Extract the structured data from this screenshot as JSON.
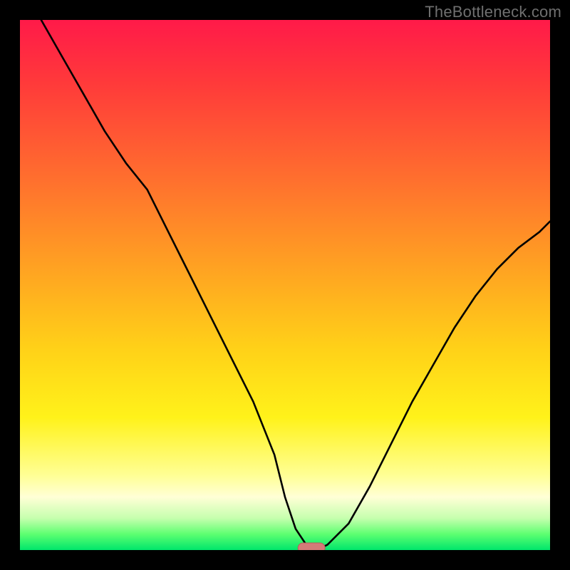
{
  "watermark": "TheBottleneck.com",
  "chart_data": {
    "type": "line",
    "title": "",
    "xlabel": "",
    "ylabel": "",
    "ylim": [
      0,
      100
    ],
    "xlim": [
      0,
      100
    ],
    "series": [
      {
        "name": "bottleneck-curve",
        "x": [
          4,
          8,
          12,
          16,
          20,
          24,
          28,
          32,
          36,
          40,
          44,
          48,
          50,
          52,
          54,
          56,
          58,
          62,
          66,
          70,
          74,
          78,
          82,
          86,
          90,
          94,
          98,
          100
        ],
        "y": [
          100,
          93,
          86,
          79,
          73,
          68,
          60,
          52,
          44,
          36,
          28,
          18,
          10,
          4,
          1,
          0,
          1,
          5,
          12,
          20,
          28,
          35,
          42,
          48,
          53,
          57,
          60,
          62
        ]
      }
    ],
    "marker": {
      "x": 55,
      "y": 0,
      "color": "#d47b78"
    },
    "gradient_stops": [
      {
        "pos": 0.0,
        "color": "#ff1a49"
      },
      {
        "pos": 0.3,
        "color": "#ff6f2e"
      },
      {
        "pos": 0.62,
        "color": "#ffd118"
      },
      {
        "pos": 0.86,
        "color": "#ffff96"
      },
      {
        "pos": 0.97,
        "color": "#5dff71"
      },
      {
        "pos": 1.0,
        "color": "#00e66b"
      }
    ]
  }
}
